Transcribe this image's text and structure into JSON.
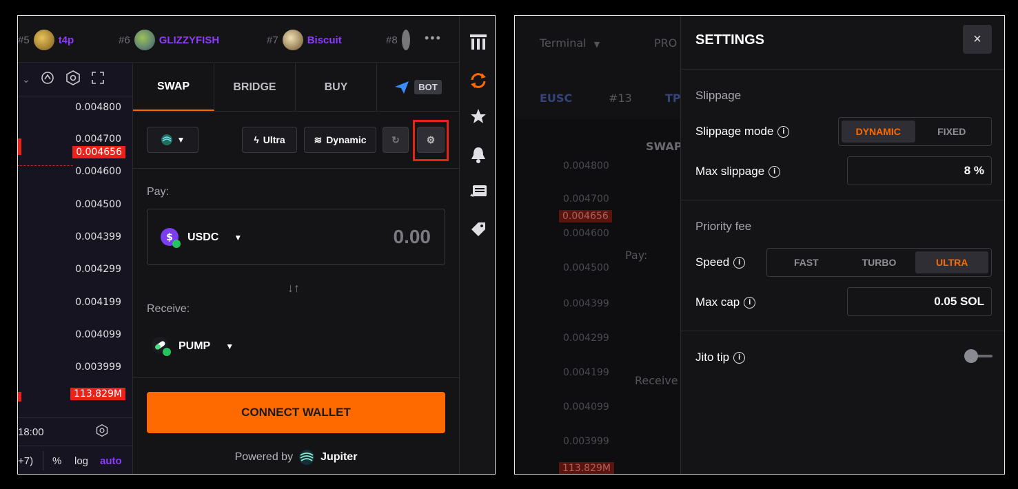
{
  "leaderboard": [
    {
      "rank": "#5",
      "name": "t4p"
    },
    {
      "rank": "#6",
      "name": "GLIZZYFISH"
    },
    {
      "rank": "#7",
      "name": "Biscuit"
    },
    {
      "rank": "#8",
      "name": ""
    }
  ],
  "leaderboard_more": "•••",
  "chart": {
    "ticks": [
      "0.004800",
      "0.004700",
      "0.004600",
      "0.004500",
      "0.004399",
      "0.004299",
      "0.004199",
      "0.004099",
      "0.003999"
    ],
    "current_price": "0.004656",
    "volume_tag": "113.829M",
    "time_label": "18:00",
    "bottom_controls": {
      "range": "+7)",
      "percent": "%",
      "log": "log",
      "auto": "auto"
    }
  },
  "swap": {
    "tabs": [
      "SWAP",
      "BRIDGE",
      "BUY",
      "BOT"
    ],
    "active_tab": "SWAP",
    "mode_ultra": "Ultra",
    "mode_dynamic": "Dynamic",
    "pay_label": "Pay:",
    "pay_token": "USDC",
    "pay_amount": "0.00",
    "switch_icon": "↓↑",
    "receive_label": "Receive:",
    "receive_token": "PUMP",
    "connect_label": "CONNECT WALLET",
    "powered_by": "Powered by",
    "powered_brand": "Jupiter"
  },
  "right_background": {
    "terminal": "Terminal",
    "pro": "PRO",
    "eusc": "EUSC",
    "rank13": "#13",
    "tp": "TP",
    "swap_tab": "SWAP",
    "pay": "Pay:",
    "receive": "Receive",
    "ticks": [
      "0.004800",
      "0.004700",
      "0.004600",
      "0.004500",
      "0.004399",
      "0.004299",
      "0.004199",
      "0.004099",
      "0.003999"
    ],
    "current_price": "0.004656",
    "volume_tag": "113.829M"
  },
  "settings": {
    "title": "SETTINGS",
    "close": "×",
    "slippage_section": "Slippage",
    "slippage_mode_label": "Slippage mode",
    "slippage_modes": [
      "DYNAMIC",
      "FIXED"
    ],
    "slippage_mode_selected": "DYNAMIC",
    "max_slippage_label": "Max slippage",
    "max_slippage_value": "8 %",
    "priority_section": "Priority fee",
    "speed_label": "Speed",
    "speeds": [
      "FAST",
      "TURBO",
      "ULTRA"
    ],
    "speed_selected": "ULTRA",
    "max_cap_label": "Max cap",
    "max_cap_value": "0.05 SOL",
    "jito_label": "Jito tip",
    "jito_enabled": false
  },
  "colors": {
    "accent": "#ff6a00",
    "name": "#8c3bff",
    "alert": "#e8231a"
  }
}
